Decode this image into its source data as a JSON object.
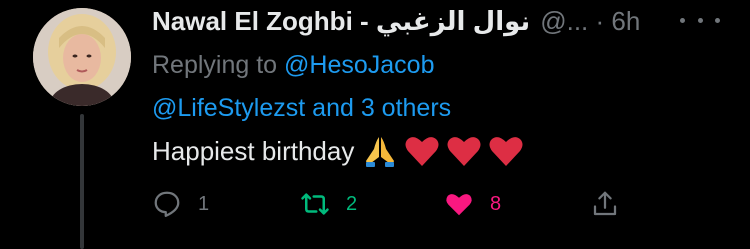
{
  "tweet": {
    "display_name": "Nawal El Zoghbi - نوال الزغبي",
    "handle_time": "@... · 6h",
    "replying_prefix": "Replying to",
    "mention_1": "@HesoJacob",
    "mention_2": "@LifeStylezst",
    "others": "and 3 others",
    "text": "Happiest birthday",
    "emojis": [
      "folded-hands",
      "red-heart",
      "red-heart",
      "red-heart"
    ]
  },
  "actions": {
    "reply_count": "1",
    "retweet_count": "2",
    "like_count": "8"
  },
  "colors": {
    "background": "#000000",
    "primary_text": "#e7e9ea",
    "secondary_text": "#71767b",
    "link": "#1d9bf0",
    "retweet_active": "#00ba7c",
    "like_active": "#f91880"
  },
  "icons": {
    "more": "more-icon",
    "reply": "reply-icon",
    "retweet": "retweet-icon",
    "like": "heart-icon",
    "share": "share-icon"
  }
}
